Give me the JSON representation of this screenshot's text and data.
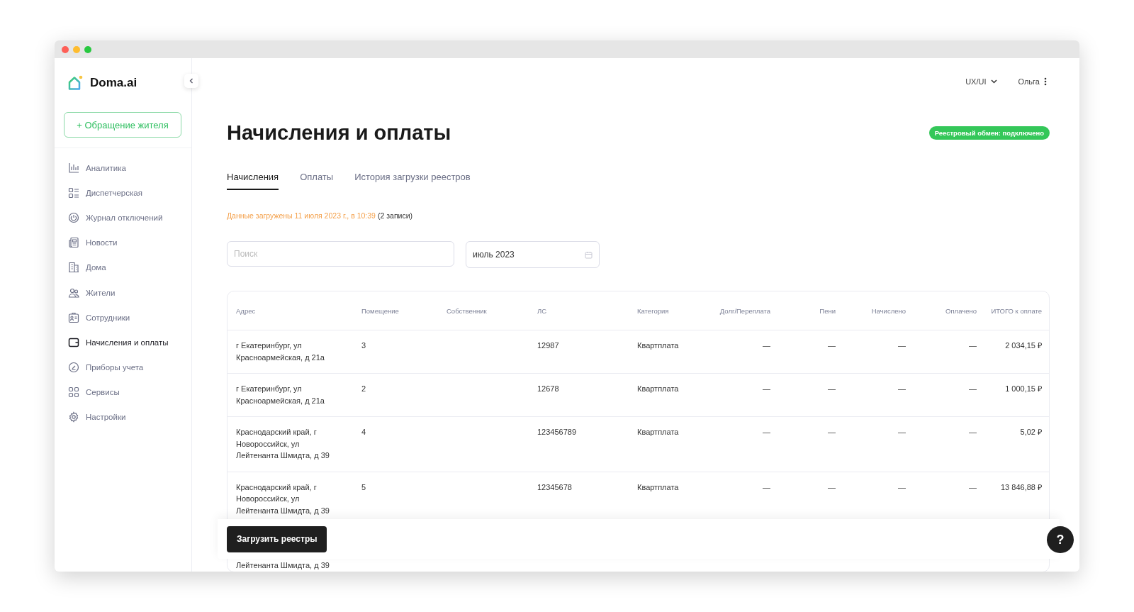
{
  "sidebar": {
    "logo": "Doma.ai",
    "new_request_button": "+ Обращение жителя",
    "items": [
      {
        "label": "Аналитика",
        "selected": false
      },
      {
        "label": "Диспетчерская",
        "selected": false
      },
      {
        "label": "Журнал отключений",
        "selected": false
      },
      {
        "label": "Новости",
        "selected": false
      },
      {
        "label": "Дома",
        "selected": false
      },
      {
        "label": "Жители",
        "selected": false
      },
      {
        "label": "Сотрудники",
        "selected": false
      },
      {
        "label": "Начисления и оплаты",
        "selected": true
      },
      {
        "label": "Приборы учета",
        "selected": false
      },
      {
        "label": "Сервисы",
        "selected": false
      },
      {
        "label": "Настройки",
        "selected": false
      }
    ]
  },
  "header": {
    "workspace": "UX/UI",
    "user": "Ольга"
  },
  "page": {
    "title": "Начисления и оплаты",
    "status_badge": "Реестровый обмен: подключено"
  },
  "tabs": [
    {
      "label": "Начисления",
      "selected": true
    },
    {
      "label": "Оплаты",
      "selected": false
    },
    {
      "label": "История загрузки реестров",
      "selected": false
    }
  ],
  "info": {
    "loaded": "Данные загружены 11 июля 2023 г., в 10:39",
    "count": "(2 записи)"
  },
  "filters": {
    "search": {
      "placeholder": "Поиск"
    },
    "month": {
      "value": "июль 2023"
    }
  },
  "table": {
    "columns": [
      "Адрес",
      "Помещение",
      "Собственник",
      "ЛС",
      "Категория",
      "Долг/Переплата",
      "Пени",
      "Начислено",
      "Оплачено",
      "ИТОГО к оплате"
    ],
    "rows": [
      {
        "kind": "full",
        "cells": [
          "г Екатеринбург, ул Красноармейская, д 21а",
          "3",
          "",
          "12987",
          "Квартплата",
          "—",
          "—",
          "—",
          "—",
          "2 034,15 ₽"
        ]
      },
      {
        "kind": "full",
        "cells": [
          "г Екатеринбург, ул Красноармейская, д 21а",
          "2",
          "",
          "12678",
          "Квартплата",
          "—",
          "—",
          "—",
          "—",
          "1 000,15 ₽"
        ]
      },
      {
        "kind": "full",
        "cells": [
          "Краснодарский край, г Новороссийск, ул Лейтенанта Шмидта, д 39",
          "4",
          "",
          "123456789",
          "Квартплата",
          "—",
          "—",
          "—",
          "—",
          "5,02 ₽"
        ]
      },
      {
        "kind": "full",
        "cells": [
          "Краснодарский край, г Новороссийск, ул Лейтенанта Шмидта, д 39",
          "5",
          "",
          "12345678",
          "Квартплата",
          "—",
          "—",
          "—",
          "—",
          "13 846,88 ₽"
        ]
      },
      {
        "kind": "partial",
        "cells": [
          "Лейтенанта Шмидта, д 39"
        ]
      }
    ]
  },
  "footer": {
    "upload_button": "Загрузить реестры",
    "help_button": "?"
  }
}
